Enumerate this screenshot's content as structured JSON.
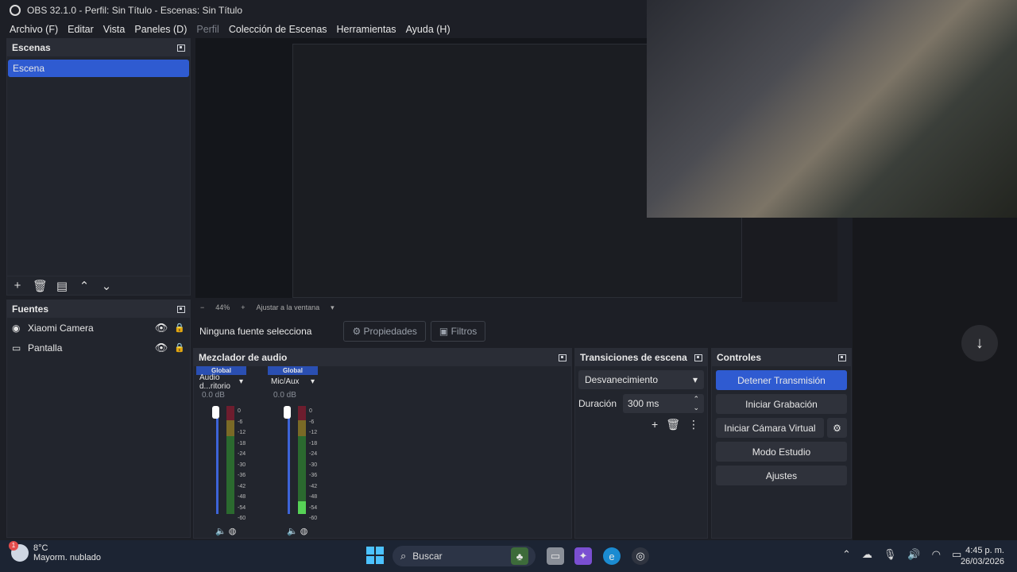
{
  "window": {
    "title": "OBS 32.1.0 - Perfil: Sin Título - Escenas: Sin Título"
  },
  "menu": [
    "Archivo (F)",
    "Editar",
    "Vista",
    "Paneles (D)",
    "Perfil",
    "Colección de Escenas",
    "Herramientas",
    "Ayuda (H)"
  ],
  "scenes": {
    "title": "Escenas",
    "items": [
      "Escena"
    ]
  },
  "sources": {
    "title": "Fuentes",
    "items": [
      {
        "label": "Xiaomi Camera",
        "icon": "camera-icon"
      },
      {
        "label": "Pantalla",
        "icon": "monitor-icon"
      }
    ]
  },
  "preview": {
    "zoom": "44%",
    "fit_label": "Ajustar a la ventana"
  },
  "source_toolbar": {
    "no_source": "Ninguna fuente selecciona",
    "properties": "Propiedades",
    "filters": "Filtros"
  },
  "mixer": {
    "title": "Mezclador de audio",
    "channels": [
      {
        "header": "Global",
        "name": "Audio d...ritorio",
        "db": "0.0 dB",
        "level": 0.0
      },
      {
        "header": "Global",
        "name": "Mic/Aux",
        "db": "0.0 dB",
        "level": 0.12
      }
    ],
    "scale": [
      "0",
      "-6",
      "-12",
      "-18",
      "-24",
      "-30",
      "-36",
      "-42",
      "-48",
      "-54",
      "-60"
    ]
  },
  "transitions": {
    "title": "Transiciones de escena",
    "selected": "Desvanecimiento",
    "duration_label": "Duración",
    "duration_value": "300 ms"
  },
  "controls": {
    "title": "Controles",
    "stop_stream": "Detener Transmisión",
    "start_record": "Iniciar Grabación",
    "start_virtual_cam": "Iniciar Cámara Virtual",
    "studio_mode": "Modo Estudio",
    "settings": "Ajustes"
  },
  "taskbar": {
    "weather_temp": "8°C",
    "weather_desc": "Mayorm. nublado",
    "weather_badge": "1",
    "search_placeholder": "Buscar",
    "time": "4:45 p. m.",
    "date": "26/03/2026"
  },
  "colors": {
    "accent": "#2f5bd1",
    "panel": "#22252d",
    "taskbar": "#1c2433"
  }
}
